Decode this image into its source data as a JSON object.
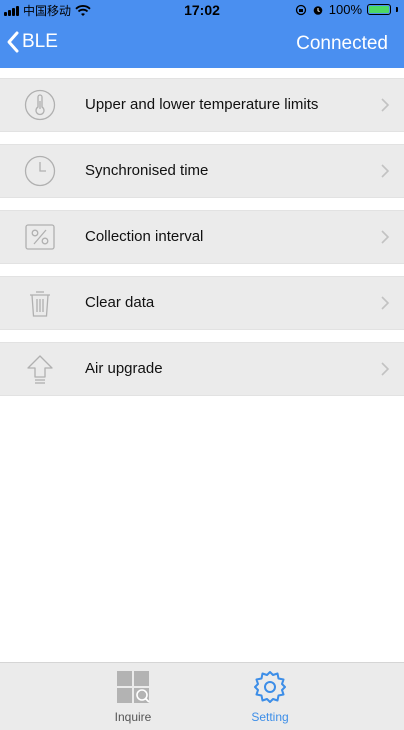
{
  "status_bar": {
    "carrier": "中国移动",
    "time": "17:02",
    "battery": "100%"
  },
  "nav": {
    "back_label": "BLE",
    "status": "Connected"
  },
  "settings": [
    {
      "label": "Upper and lower temperature limits",
      "icon": "thermometer-icon"
    },
    {
      "label": "Synchronised time",
      "icon": "clock-icon"
    },
    {
      "label": "Collection interval",
      "icon": "percent-icon"
    },
    {
      "label": "Clear data",
      "icon": "trash-icon"
    },
    {
      "label": "Air upgrade",
      "icon": "upgrade-arrow-icon"
    }
  ],
  "tabs": [
    {
      "label": "Inquire",
      "icon": "inquire-grid-icon",
      "active": false
    },
    {
      "label": "Setting",
      "icon": "gear-icon",
      "active": true
    }
  ],
  "colors": {
    "accent": "#4a8ff0",
    "row_bg": "#ebebeb",
    "icon_gray": "#b0b0b0",
    "tab_active": "#3d8ee8",
    "tab_inactive": "#555555"
  }
}
